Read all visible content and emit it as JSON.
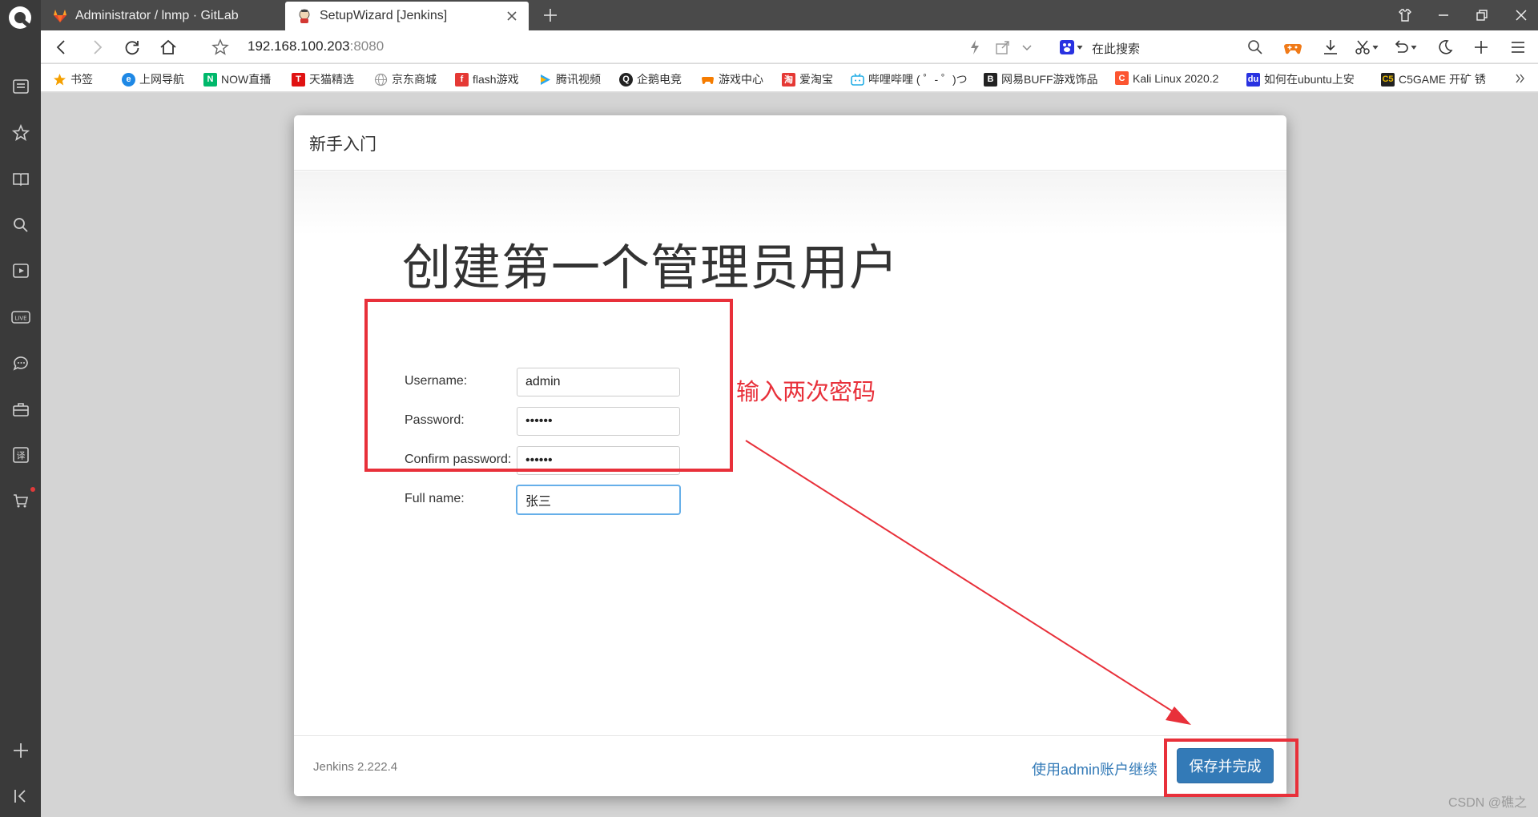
{
  "browser": {
    "tabs": [
      {
        "label": "Administrator / lnmp · GitLab",
        "active": false,
        "icon": "gitlab-icon"
      },
      {
        "label": "SetupWizard [Jenkins]",
        "active": true,
        "icon": "jenkins-icon"
      }
    ],
    "address": {
      "host": "192.168.100.203",
      "port": ":8080"
    },
    "search_placeholder": "在此搜索",
    "bookmarks": [
      {
        "label": "书签",
        "icon": "star-icon",
        "color": "#f5a000"
      },
      {
        "label": "上网导航",
        "icon": "ie-icon",
        "color": "#1e88e5"
      },
      {
        "label": "NOW直播",
        "icon": "now-icon",
        "color": "#00b86b"
      },
      {
        "label": "天猫精选",
        "icon": "tmall-icon",
        "color": "#e01212"
      },
      {
        "label": "京东商城",
        "icon": "globe-icon",
        "color": "#9a9a9a"
      },
      {
        "label": "flash游戏",
        "icon": "flash-icon",
        "color": "#e53935"
      },
      {
        "label": "腾讯视频",
        "icon": "video-icon",
        "color": "#2aa7f0"
      },
      {
        "label": "企鹅电竞",
        "icon": "penguin-icon",
        "color": "#222222"
      },
      {
        "label": "游戏中心",
        "icon": "gamepad-icon",
        "color": "#f57c00"
      },
      {
        "label": "爱淘宝",
        "icon": "taobao-icon",
        "color": "#e53935"
      },
      {
        "label": "哔哩哔哩 ( ゜- ゜)つ",
        "icon": "bilibili-icon",
        "color": "#23ade5"
      },
      {
        "label": "网易BUFF游戏饰品",
        "icon": "buff-icon",
        "color": "#222222"
      },
      {
        "label": "Kali Linux 2020.2",
        "icon": "csdn-icon",
        "color": "#fc5531"
      },
      {
        "label": "如何在ubuntu上安",
        "icon": "baidu-icon",
        "color": "#2932e1"
      },
      {
        "label": "C5GAME 开矿 锈",
        "icon": "c5-icon",
        "color": "#e6b800"
      }
    ]
  },
  "dialog": {
    "header": "新手入门",
    "title": "创建第一个管理员用户",
    "fields": {
      "username": {
        "label": "Username:",
        "value": "admin"
      },
      "password": {
        "label": "Password:",
        "value": "••••••"
      },
      "confirm": {
        "label": "Confirm password:",
        "value": "••••••"
      },
      "fullname": {
        "label": "Full name:",
        "value": "张三"
      }
    },
    "version": "Jenkins 2.222.4",
    "skip_link": "使用admin账户继续",
    "save_button": "保存并完成"
  },
  "annotation": {
    "text": "输入两次密码",
    "color": "#e8303a"
  },
  "watermark": "CSDN @礁之"
}
